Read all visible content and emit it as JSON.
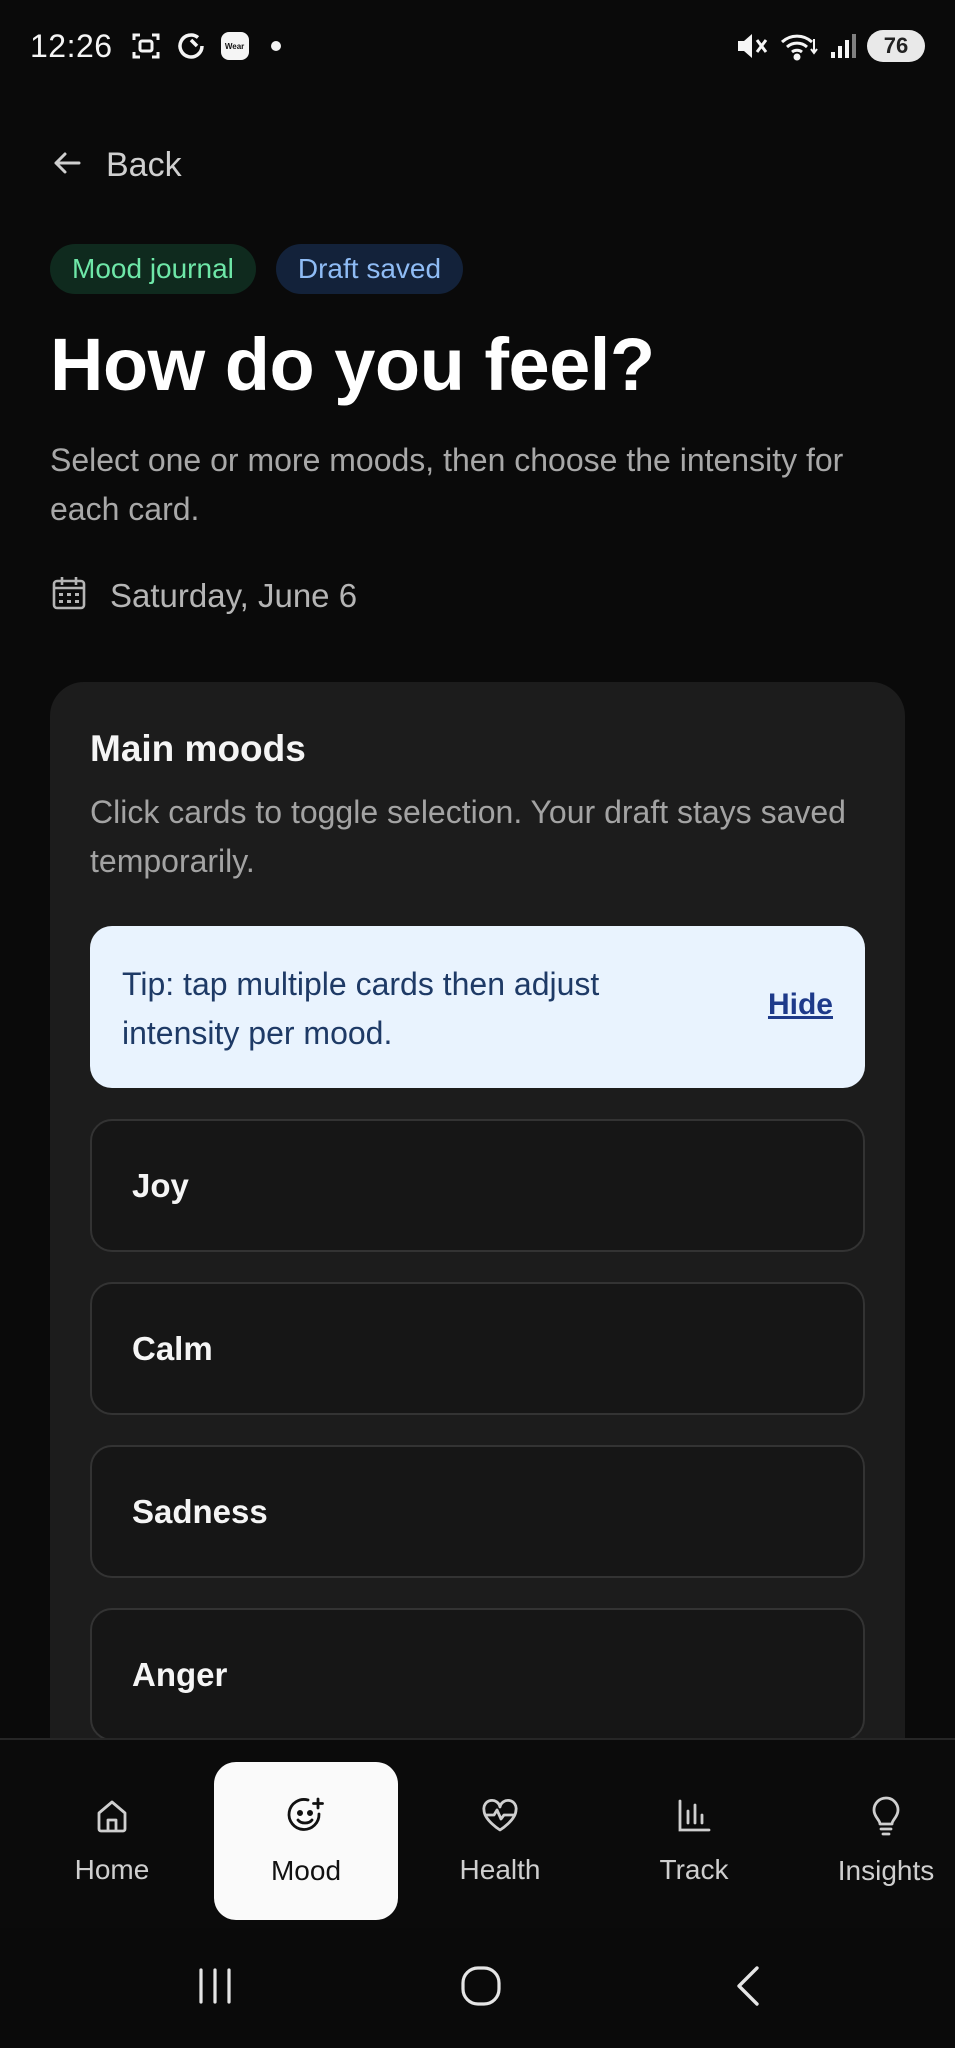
{
  "status_bar": {
    "time": "12:26",
    "wear_badge": "Wear",
    "battery": "76"
  },
  "header": {
    "back_label": "Back",
    "chips": [
      "Mood journal",
      "Draft saved"
    ],
    "title": "How do you feel?",
    "subtitle": "Select one or more moods, then choose the intensity for each card.",
    "date": "Saturday, June 6"
  },
  "card": {
    "title": "Main moods",
    "description": "Click cards to toggle selection. Your draft stays saved temporarily.",
    "tip": {
      "text": "Tip: tap multiple cards then adjust intensity per mood.",
      "hide_label": "Hide"
    },
    "moods": [
      "Joy",
      "Calm",
      "Sadness",
      "Anger"
    ]
  },
  "bottom_nav": {
    "items": [
      {
        "label": "Home",
        "icon": "home-icon",
        "active": false
      },
      {
        "label": "Mood",
        "icon": "smiley-plus-icon",
        "active": true
      },
      {
        "label": "Health",
        "icon": "heart-pulse-icon",
        "active": false
      },
      {
        "label": "Track",
        "icon": "bar-chart-icon",
        "active": false
      },
      {
        "label": "Insights",
        "icon": "lightbulb-icon",
        "active": false
      }
    ]
  },
  "colors": {
    "background": "#0a0a0a",
    "card": "#1c1c1c",
    "tip_bg": "#e9f3fe",
    "chip_mood_text": "#6ee7a8",
    "chip_draft_text": "#8fbcf5"
  }
}
